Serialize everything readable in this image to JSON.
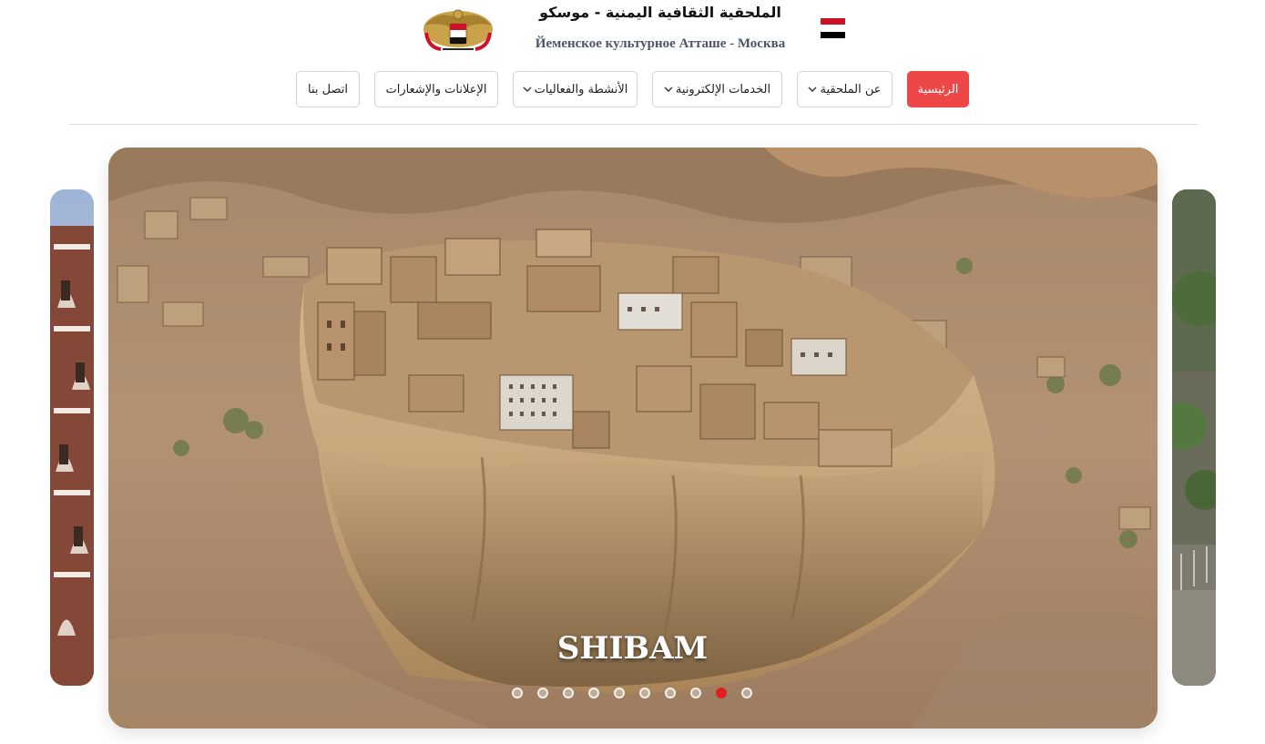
{
  "header": {
    "title_ar": "الملحقية الثقافية اليمنية - موسكو",
    "title_ru": "Йеменское культурное Атташе - Москва",
    "emblem_icon": "yemen-emblem-icon",
    "flag_colors": [
      "#ce1126",
      "#ffffff",
      "#000000"
    ]
  },
  "nav": {
    "items": [
      {
        "label": "الرئيسية",
        "active": true,
        "dropdown": false
      },
      {
        "label": "عن الملحقية",
        "active": false,
        "dropdown": true
      },
      {
        "label": "الخدمات الإلكترونية",
        "active": false,
        "dropdown": true
      },
      {
        "label": "الأنشطة والفعاليات",
        "active": false,
        "dropdown": true
      },
      {
        "label": "الإعلانات والإشعارات",
        "active": false,
        "dropdown": false
      },
      {
        "label": "اتصل بنا",
        "active": false,
        "dropdown": false
      }
    ],
    "accent_color": "#ee4747"
  },
  "slider": {
    "caption": "SHIBAM",
    "slide_count": 10,
    "active_index": 9,
    "active_dot_color": "#e02020"
  }
}
